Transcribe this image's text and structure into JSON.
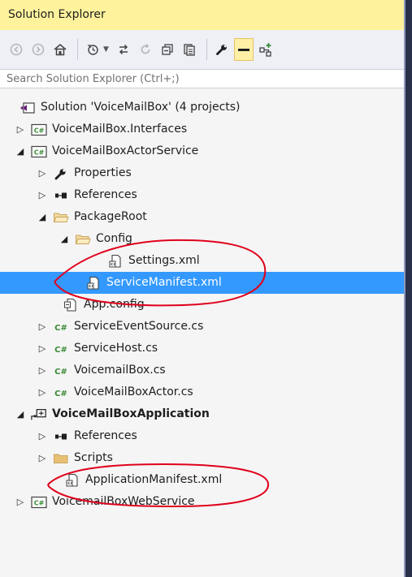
{
  "window": {
    "title": "Solution Explorer"
  },
  "search": {
    "placeholder": "Search Solution Explorer (Ctrl+;)"
  },
  "toolbar": {
    "buttons": [
      "back-icon",
      "forward-icon",
      "home-icon",
      "history-icon",
      "sync-icon",
      "refresh-icon",
      "collapse-all-icon",
      "show-all-files-icon",
      "properties-icon",
      "preview-icon",
      "class-view-icon"
    ]
  },
  "tree": {
    "solution": "Solution 'VoiceMailBox' (4 projects)",
    "interfaces": "VoiceMailBox.Interfaces",
    "actor_service": "VoiceMailBoxActorService",
    "properties": "Properties",
    "references": "References",
    "package_root": "PackageRoot",
    "config": "Config",
    "settings": "Settings.xml",
    "service_manifest": "ServiceManifest.xml",
    "app_config": "App.config",
    "service_event_source": "ServiceEventSource.cs",
    "service_host": "ServiceHost.cs",
    "voicemail_box": "VoicemailBox.cs",
    "voicemail_box_actor": "VoiceMailBoxActor.cs",
    "application": "VoiceMailBoxApplication",
    "app_references": "References",
    "scripts": "Scripts",
    "application_manifest": "ApplicationManifest.xml",
    "web_service": "VoicemailBoxWebService"
  },
  "colors": {
    "title_bg": "#fff29d",
    "selection": "#3399ff",
    "annotation": "#e0001b",
    "csharp_green": "#388a34"
  }
}
